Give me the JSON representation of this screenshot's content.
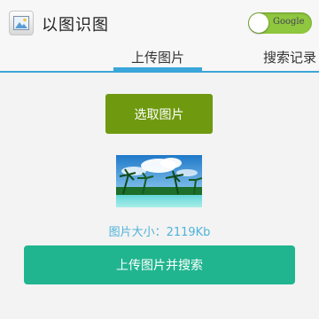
{
  "appbar": {
    "icon": "image-picture-icon",
    "title": "以图识图",
    "toggle": {
      "label": "Google",
      "state": "on",
      "color": "#8fc73e"
    }
  },
  "tabs": [
    {
      "label": "上传图片",
      "selected": true
    },
    {
      "label": "搜索记录",
      "selected": false
    }
  ],
  "main": {
    "select_button_label": "选取图片",
    "preview_image": "beach-palm-trees-image",
    "size_text": "图片大小：2119Kb",
    "upload_button_label": "上传图片并搜索"
  },
  "colors": {
    "accent": "#3aa6d9",
    "select_button": "#6f9a10",
    "upload_button": "#20b58f",
    "size_text": "#4fb3d8"
  }
}
